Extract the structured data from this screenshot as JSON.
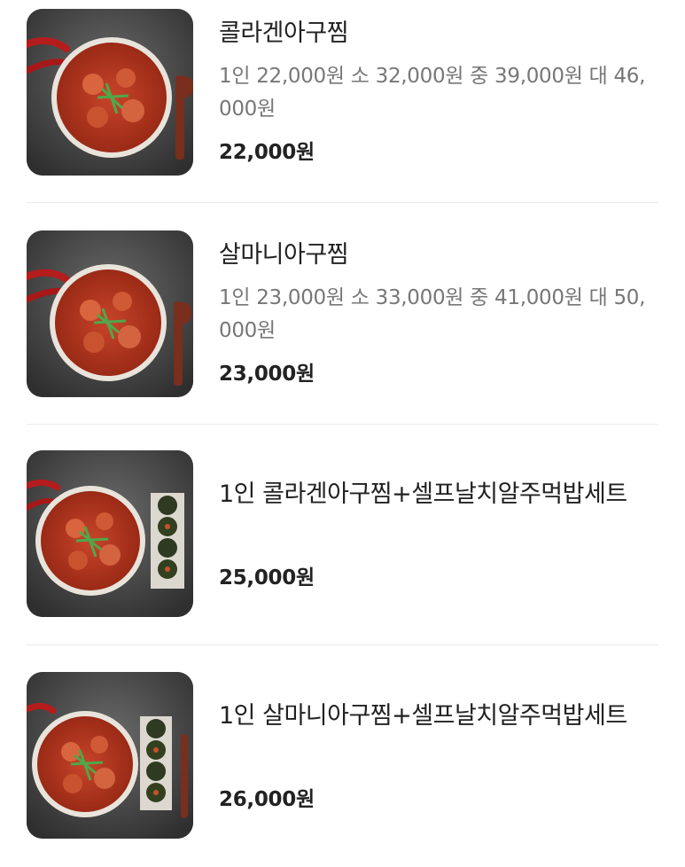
{
  "menu": {
    "items": [
      {
        "name": "콜라겐아구찜",
        "description": "1인 22,000원 소 32,000원 중 39,000원 대 46,000원",
        "price": "22,000원",
        "image_icon": "braised-monkfish-photo"
      },
      {
        "name": "살마니아구찜",
        "description": "1인 23,000원 소 33,000원 중 41,000원 대 50,000원",
        "price": "23,000원",
        "image_icon": "braised-monkfish-photo"
      },
      {
        "name": "1인 콜라겐아구찜+셀프날치알주먹밥세트",
        "price": "25,000원",
        "image_icon": "monkfish-set-with-riceballs-photo"
      },
      {
        "name": "1인 살마니아구찜+셀프날치알주먹밥세트",
        "price": "26,000원",
        "image_icon": "monkfish-set-with-riceballs-photo"
      }
    ]
  },
  "colors": {
    "title": "#222222",
    "description": "#777777",
    "divider": "#ececec",
    "background": "#ffffff"
  }
}
